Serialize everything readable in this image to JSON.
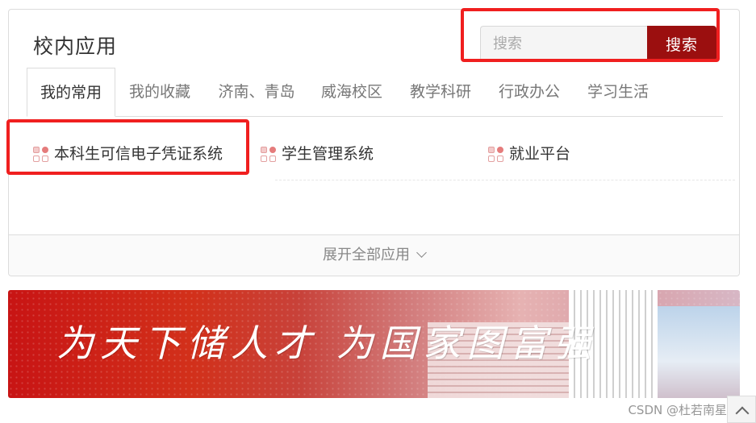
{
  "card": {
    "title": "校内应用",
    "search": {
      "placeholder": "搜索",
      "button_label": "搜索"
    },
    "tabs": [
      {
        "label": "我的常用",
        "active": true
      },
      {
        "label": "我的收藏",
        "active": false
      },
      {
        "label": "济南、青岛",
        "active": false
      },
      {
        "label": "威海校区",
        "active": false
      },
      {
        "label": "教学科研",
        "active": false
      },
      {
        "label": "行政办公",
        "active": false
      },
      {
        "label": "学习生活",
        "active": false
      }
    ],
    "apps": [
      {
        "label": "本科生可信电子凭证系统",
        "icon": "app-grid-icon"
      },
      {
        "label": "学生管理系统",
        "icon": "app-grid-icon"
      },
      {
        "label": "就业平台",
        "icon": "app-grid-icon"
      }
    ],
    "expand_label": "展开全部应用"
  },
  "banner": {
    "slogan": "为天下储人才 为国家图富强"
  },
  "watermark": "CSDN @杜若南星",
  "colors": {
    "accent": "#9b0f0f",
    "highlight": "#f01f1f"
  }
}
